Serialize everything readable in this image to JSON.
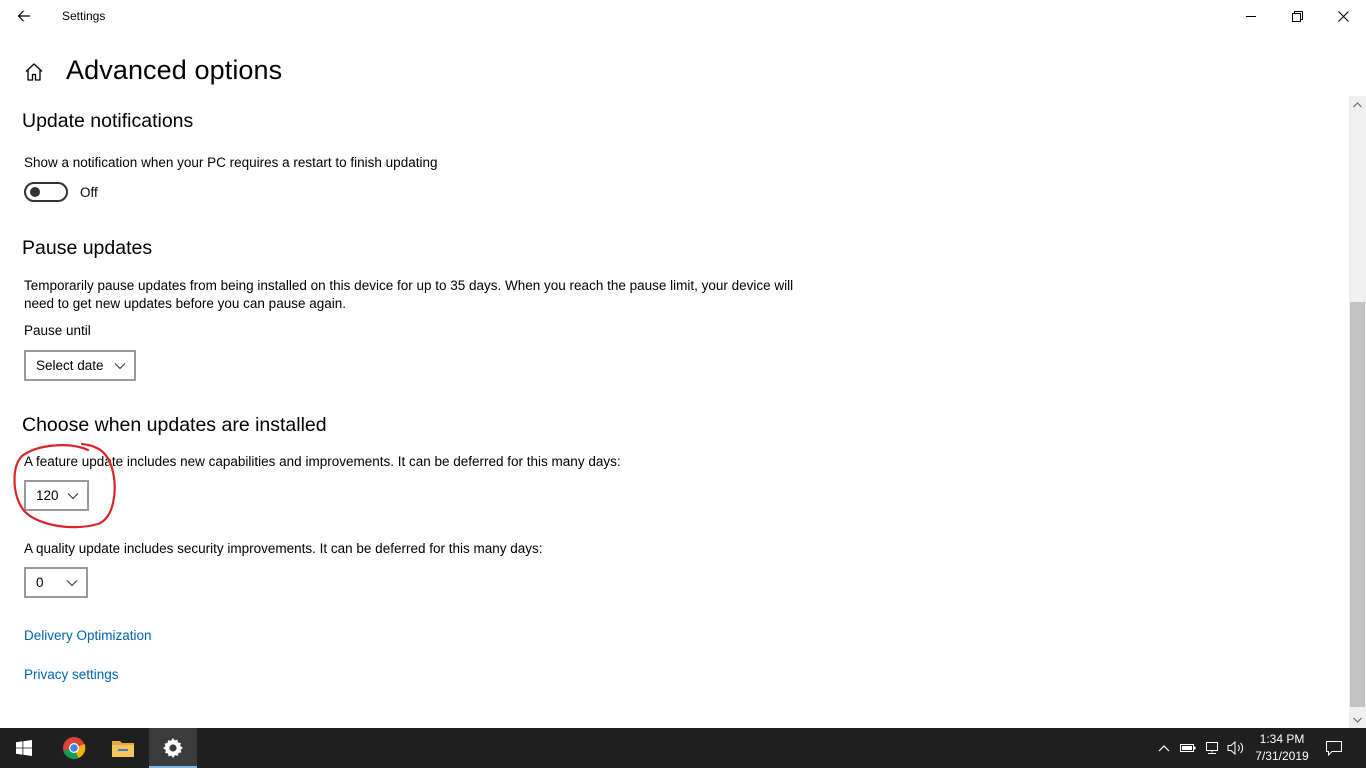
{
  "window": {
    "title": "Settings"
  },
  "page": {
    "title": "Advanced options"
  },
  "update_notifications": {
    "heading": "Update notifications",
    "description": "Show a notification when your PC requires a restart to finish updating",
    "toggle_state": "Off"
  },
  "pause_updates": {
    "heading": "Pause updates",
    "description_line1": "Temporarily pause updates from being installed on this device for up to 35 days. When you reach the pause limit, your device will",
    "description_line2": "need to get new updates before you can pause again.",
    "pause_until_label": "Pause until",
    "select_date_value": "Select date"
  },
  "choose_when": {
    "heading": "Choose when updates are installed",
    "feature_text": "A feature update includes new capabilities and improvements. It can be deferred for this many days:",
    "feature_value": "120",
    "quality_text": "A quality update includes security improvements. It can be deferred for this many days:",
    "quality_value": "0"
  },
  "links": {
    "delivery_optimization": "Delivery Optimization",
    "privacy_settings": "Privacy settings"
  },
  "taskbar": {
    "time": "1:34 PM",
    "date": "7/31/2019"
  },
  "colors": {
    "link": "#0063b1",
    "taskbar": "#1f1f1f",
    "annotation": "#d9262c"
  }
}
